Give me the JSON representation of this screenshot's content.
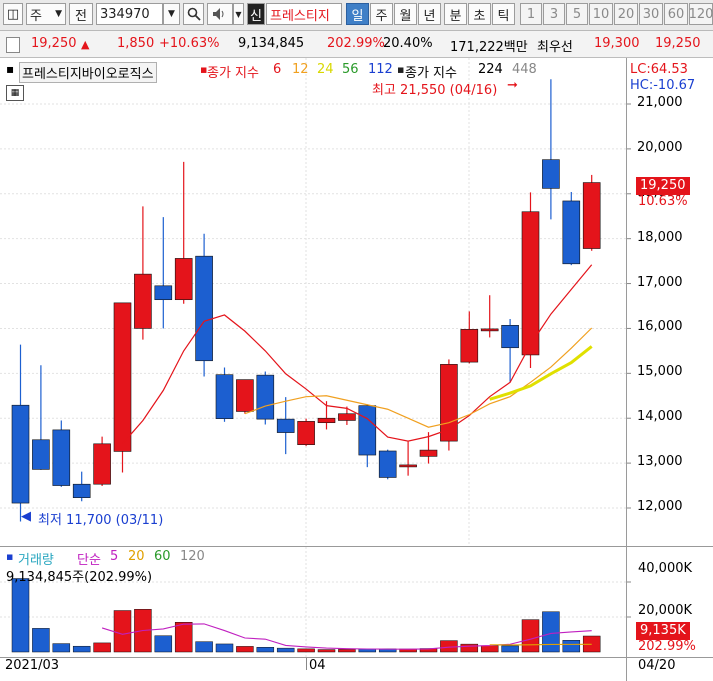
{
  "toolbar": {
    "type_label": "주",
    "prev_label": "전",
    "code_value": "334970",
    "new_label": "신",
    "stock_name": "프레스티지",
    "period_tabs": [
      "일",
      "주",
      "월",
      "년",
      "분",
      "초",
      "틱"
    ],
    "interval_tabs": [
      "1",
      "3",
      "5",
      "10",
      "20",
      "30",
      "60",
      "120"
    ]
  },
  "quote": {
    "price": "19,250",
    "change": "1,850",
    "change_pct": "+10.63%",
    "volume": "9,134,845",
    "volume_ratio": "202.99%",
    "turnover": "20.40%",
    "amount": "171,222백만",
    "best_label": "최우선",
    "ask": "19,300",
    "bid": "19,250"
  },
  "legend": {
    "name": "프레스티지바이오로직스",
    "ma_label": "종가 지수",
    "ma_periods": [
      "6",
      "12",
      "24",
      "56",
      "112"
    ],
    "ma_colors": [
      "#e4141b",
      "#f0a020",
      "#e0e000",
      "#2a9a2a",
      "#1a3fd0"
    ],
    "ma2_label": "종가 지수",
    "ma2_periods": [
      "224",
      "448"
    ],
    "ma2_colors": [
      "#222222",
      "#888888"
    ]
  },
  "annotations": {
    "high": "최고 21,550 (04/16)",
    "low": "최저 11,700 (03/11)"
  },
  "right_info": {
    "lc": "LC:64.53",
    "hc": "HC:-10.67"
  },
  "price_axis": {
    "ticks": [
      "21,000",
      "20,000",
      "19,000",
      "18,000",
      "17,000",
      "16,000",
      "15,000",
      "14,000",
      "13,000",
      "12,000"
    ],
    "current": "19,250",
    "current_pct": "10.63%"
  },
  "volume_panel": {
    "title": "거래량",
    "ma_label": "단순",
    "ma_periods": [
      "5",
      "20",
      "60",
      "120"
    ],
    "ma_colors": [
      "#c020c0",
      "#e0a000",
      "#2a9a2a",
      "#888888"
    ],
    "current": "9,134,845주(202.99%)",
    "ticks": [
      "40,000K",
      "20,000K"
    ],
    "current_chip": "9,135K",
    "current_pct": "202.99%"
  },
  "x_axis": {
    "left": "2021/03",
    "mid": "04",
    "right": "04/20"
  },
  "colors": {
    "up": "#e4141b",
    "down": "#1c5fd0",
    "ma6": "#e4141b",
    "ma12": "#f0a020",
    "ma24": "#e0e000"
  },
  "chart_data": {
    "type": "candlestick",
    "price_range": [
      11600,
      21800
    ],
    "candles": [
      {
        "o": 14290,
        "h": 15640,
        "l": 11700,
        "c": 12110
      },
      {
        "o": 13520,
        "h": 15180,
        "l": 12850,
        "c": 12860
      },
      {
        "o": 13740,
        "h": 13950,
        "l": 12470,
        "c": 12500
      },
      {
        "o": 12530,
        "h": 12810,
        "l": 12150,
        "c": 12230
      },
      {
        "o": 12530,
        "h": 13590,
        "l": 12490,
        "c": 13430
      },
      {
        "o": 13260,
        "h": 15660,
        "l": 12790,
        "c": 16570
      },
      {
        "o": 16000,
        "h": 18720,
        "l": 15750,
        "c": 17210
      },
      {
        "o": 16950,
        "h": 18480,
        "l": 16000,
        "c": 16640
      },
      {
        "o": 16640,
        "h": 19710,
        "l": 16550,
        "c": 17560
      },
      {
        "o": 17610,
        "h": 18110,
        "l": 14930,
        "c": 15280
      },
      {
        "o": 14970,
        "h": 15130,
        "l": 13920,
        "c": 13990
      },
      {
        "o": 14150,
        "h": 14860,
        "l": 14100,
        "c": 14860
      },
      {
        "o": 14960,
        "h": 15040,
        "l": 13860,
        "c": 13980
      },
      {
        "o": 13980,
        "h": 14470,
        "l": 13200,
        "c": 13680
      },
      {
        "o": 13410,
        "h": 13990,
        "l": 13380,
        "c": 13930
      },
      {
        "o": 13900,
        "h": 14380,
        "l": 13750,
        "c": 14000
      },
      {
        "o": 13950,
        "h": 14260,
        "l": 13850,
        "c": 14100
      },
      {
        "o": 14280,
        "h": 14310,
        "l": 12910,
        "c": 13180
      },
      {
        "o": 13270,
        "h": 13300,
        "l": 12640,
        "c": 12680
      },
      {
        "o": 12950,
        "h": 13480,
        "l": 12720,
        "c": 12960
      },
      {
        "o": 13150,
        "h": 13690,
        "l": 12990,
        "c": 13290
      },
      {
        "o": 13490,
        "h": 15310,
        "l": 13280,
        "c": 15200
      },
      {
        "o": 15250,
        "h": 16380,
        "l": 15220,
        "c": 15980
      },
      {
        "o": 15950,
        "h": 16740,
        "l": 15800,
        "c": 15990
      },
      {
        "o": 16070,
        "h": 16210,
        "l": 14810,
        "c": 15570
      },
      {
        "o": 15410,
        "h": 19030,
        "l": 15120,
        "c": 18600
      },
      {
        "o": 19760,
        "h": 21550,
        "l": 18430,
        "c": 19120
      },
      {
        "o": 18840,
        "h": 19040,
        "l": 17410,
        "c": 17440
      },
      {
        "o": 17780,
        "h": 19420,
        "l": 17730,
        "c": 19250
      }
    ],
    "ma6": [
      null,
      null,
      null,
      null,
      null,
      13430,
      13950,
      14620,
      15500,
      16160,
      16300,
      15940,
      15500,
      14990,
      14650,
      14280,
      14220,
      13990,
      13580,
      13490,
      13590,
      13750,
      14060,
      14480,
      14800,
      15640,
      16320,
      16870,
      17420
    ],
    "ma12": [
      null,
      null,
      null,
      null,
      null,
      null,
      null,
      null,
      null,
      null,
      null,
      14100,
      14270,
      14380,
      14480,
      14500,
      14400,
      14300,
      14200,
      14000,
      13800,
      13900,
      14080,
      14320,
      14480,
      14800,
      15140,
      15560,
      16010
    ],
    "ma24": [
      null,
      null,
      null,
      null,
      null,
      null,
      null,
      null,
      null,
      null,
      null,
      null,
      null,
      null,
      null,
      null,
      null,
      null,
      null,
      null,
      null,
      null,
      null,
      14420,
      14560,
      14720,
      14990,
      15240,
      15600
    ],
    "volume_range": [
      0,
      48000
    ],
    "volume_k": [
      42000,
      13500,
      4800,
      3300,
      5200,
      23700,
      24400,
      9300,
      17000,
      5900,
      4600,
      3200,
      2700,
      2200,
      1800,
      1400,
      1500,
      1700,
      1800,
      1700,
      2000,
      6500,
      4500,
      3600,
      3500,
      18500,
      23000,
      6700,
      9135
    ],
    "vol_ma5": [
      null,
      null,
      null,
      null,
      13760,
      10100,
      12280,
      13180,
      15920,
      16060,
      12240,
      8000,
      7340,
      3740,
      2900,
      2260,
      1920,
      1720,
      1640,
      1620,
      1740,
      2740,
      3300,
      3660,
      4420,
      7320,
      10620,
      11460,
      12170
    ],
    "vol_ma20": [
      null,
      null,
      null,
      null,
      null,
      null,
      null,
      null,
      null,
      null,
      null,
      null,
      null,
      null,
      null,
      null,
      null,
      null,
      null,
      null,
      null,
      null,
      null,
      4100,
      4050,
      4100,
      4300,
      4350,
      4400
    ]
  }
}
